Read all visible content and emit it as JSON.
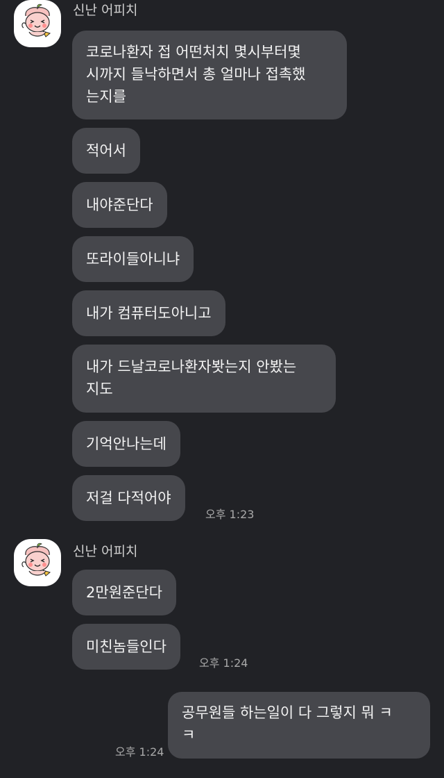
{
  "chat": {
    "group1": {
      "sender": "신난 어피치",
      "messages": [
        "코로나환자 접 어떤처치 몇시부터몇\n시까지 들낙하면서 총 얼마나 접촉했\n는지를",
        "적어서",
        "내야준단다",
        "또라이들아니냐",
        "내가 컴퓨터도아니고",
        "내가 드날코로나환자봣는지 안봤는\n지도",
        "기억안나는데",
        "저걸 다적어야"
      ],
      "time": "오후 1:23"
    },
    "group2": {
      "sender": "신난 어피치",
      "messages": [
        "2만원준단다",
        "미친놈들인다"
      ],
      "time": "오후 1:24"
    },
    "mine": {
      "message": "공무원들 하는일이 다 그렇지 뭐 ㅋ\nㅋ",
      "time": "오후 1:24"
    },
    "avatar_icon": "peach-character-icon",
    "colors": {
      "background": "#212226",
      "bubble": "#46474c",
      "avatar_bg": "#ffffff",
      "peach": "#f8c8c4"
    }
  }
}
